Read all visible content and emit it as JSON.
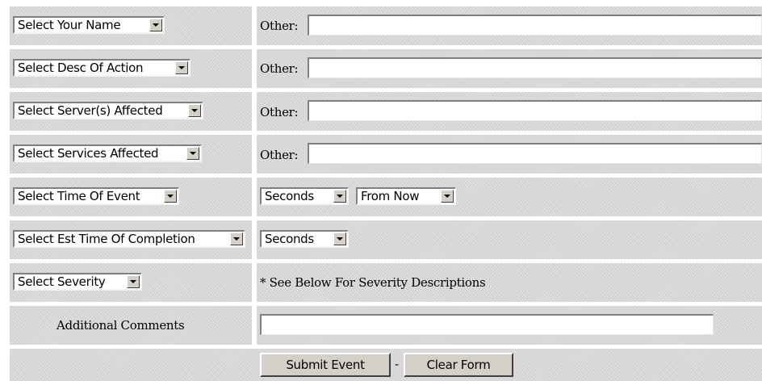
{
  "rows": {
    "name": {
      "select": "Select Your Name",
      "other_label": "Other:",
      "other_value": ""
    },
    "action": {
      "select": "Select Desc Of Action",
      "other_label": "Other:",
      "other_value": ""
    },
    "servers": {
      "select": "Select Server(s) Affected",
      "other_label": "Other:",
      "other_value": ""
    },
    "services": {
      "select": "Select Services Affected",
      "other_label": "Other:",
      "other_value": ""
    },
    "time_of_event": {
      "select": "Select Time Of Event",
      "unit": "Seconds",
      "relation": "From Now"
    },
    "completion": {
      "select": "Select Est Time Of Completion",
      "unit": "Seconds"
    },
    "severity": {
      "select": "Select Severity",
      "note": "* See Below For Severity Descriptions"
    },
    "comments": {
      "label": "Additional Comments",
      "value": ""
    }
  },
  "buttons": {
    "submit": "Submit Event",
    "separator": "-",
    "clear": "Clear Form"
  }
}
